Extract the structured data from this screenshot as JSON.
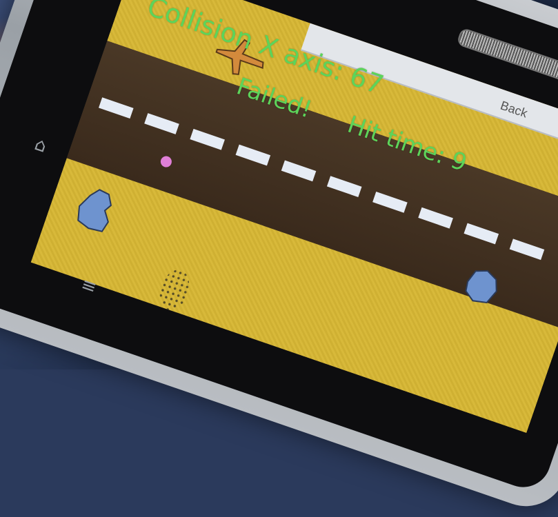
{
  "app": {
    "back_label": "Back"
  },
  "hud": {
    "collision_text": "Collision X axis: 67",
    "status_text": "Failed!",
    "hit_time_text": "Hit time: 9"
  },
  "icons": {
    "plane": "plane-icon",
    "blob_left": "blob-icon",
    "blob_right": "blob-icon",
    "ball": "ball-icon",
    "home": "home-icon",
    "menu": "menu-icon"
  },
  "colors": {
    "hud_text": "#5dd45a",
    "lane": "#d8b93a",
    "road": "#3a2a1c",
    "lane_dash": "#e6ecf5",
    "blob": "#6e93cf",
    "plane": "#d38a3c",
    "ball": "#e07fd7"
  }
}
